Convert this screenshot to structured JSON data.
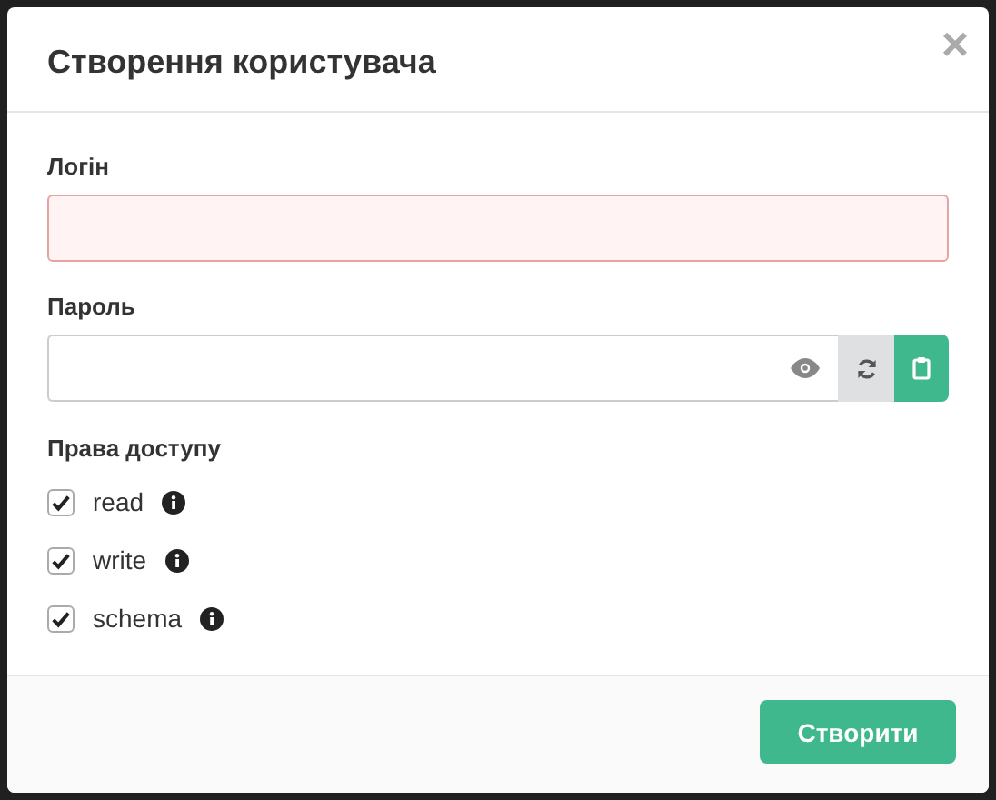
{
  "dialog": {
    "title": "Створення користувача",
    "close": "×"
  },
  "login": {
    "label": "Логін",
    "invalid": true
  },
  "password": {
    "label": "Пароль"
  },
  "permissions": {
    "label": "Права доступу",
    "items": [
      {
        "label": "read",
        "checked": true
      },
      {
        "label": "write",
        "checked": true
      },
      {
        "label": "schema",
        "checked": true
      }
    ]
  },
  "buttons": [
    {
      "label": "Створити"
    }
  ]
}
